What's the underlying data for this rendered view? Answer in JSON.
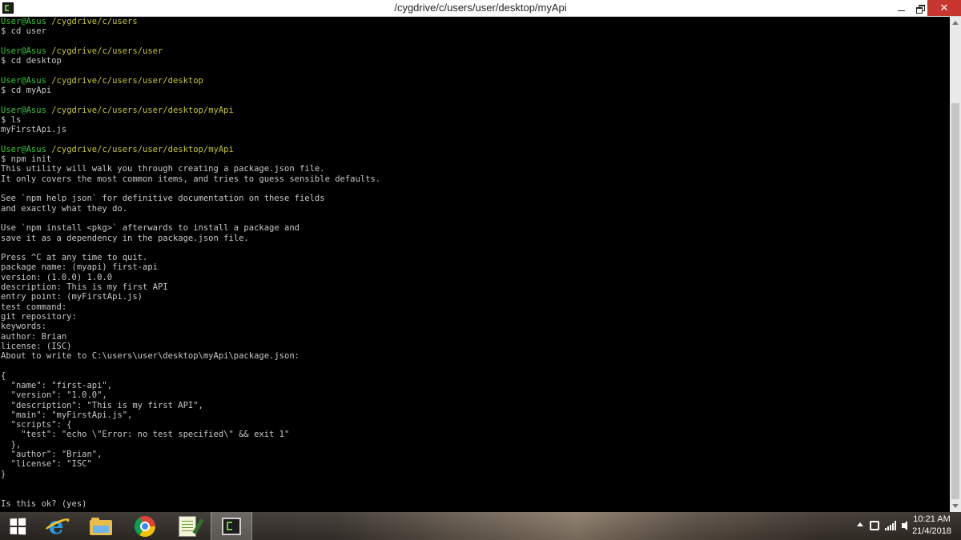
{
  "window": {
    "title": "/cygdrive/c/users/user/desktop/myApi",
    "minimize_glyph": "",
    "close_glyph": "✕"
  },
  "terminal": {
    "lines": [
      {
        "type": "prompt",
        "user": "User@Asus",
        "path": "/cygdrive/c/users"
      },
      {
        "type": "text",
        "text": "$ cd user"
      },
      {
        "type": "text",
        "text": ""
      },
      {
        "type": "prompt",
        "user": "User@Asus",
        "path": "/cygdrive/c/users/user"
      },
      {
        "type": "text",
        "text": "$ cd desktop"
      },
      {
        "type": "text",
        "text": ""
      },
      {
        "type": "prompt",
        "user": "User@Asus",
        "path": "/cygdrive/c/users/user/desktop"
      },
      {
        "type": "text",
        "text": "$ cd myApi"
      },
      {
        "type": "text",
        "text": ""
      },
      {
        "type": "prompt",
        "user": "User@Asus",
        "path": "/cygdrive/c/users/user/desktop/myApi"
      },
      {
        "type": "text",
        "text": "$ ls"
      },
      {
        "type": "text",
        "text": "myFirstApi.js"
      },
      {
        "type": "text",
        "text": ""
      },
      {
        "type": "prompt",
        "user": "User@Asus",
        "path": "/cygdrive/c/users/user/desktop/myApi"
      },
      {
        "type": "text",
        "text": "$ npm init"
      },
      {
        "type": "text",
        "text": "This utility will walk you through creating a package.json file."
      },
      {
        "type": "text",
        "text": "It only covers the most common items, and tries to guess sensible defaults."
      },
      {
        "type": "text",
        "text": ""
      },
      {
        "type": "text",
        "text": "See `npm help json` for definitive documentation on these fields"
      },
      {
        "type": "text",
        "text": "and exactly what they do."
      },
      {
        "type": "text",
        "text": ""
      },
      {
        "type": "text",
        "text": "Use `npm install <pkg>` afterwards to install a package and"
      },
      {
        "type": "text",
        "text": "save it as a dependency in the package.json file."
      },
      {
        "type": "text",
        "text": ""
      },
      {
        "type": "text",
        "text": "Press ^C at any time to quit."
      },
      {
        "type": "text",
        "text": "package name: (myapi) first-api"
      },
      {
        "type": "text",
        "text": "version: (1.0.0) 1.0.0"
      },
      {
        "type": "text",
        "text": "description: This is my first API"
      },
      {
        "type": "text",
        "text": "entry point: (myFirstApi.js)"
      },
      {
        "type": "text",
        "text": "test command:"
      },
      {
        "type": "text",
        "text": "git repository:"
      },
      {
        "type": "text",
        "text": "keywords:"
      },
      {
        "type": "text",
        "text": "author: Brian"
      },
      {
        "type": "text",
        "text": "license: (ISC)"
      },
      {
        "type": "text",
        "text": "About to write to C:\\users\\user\\desktop\\myApi\\package.json:"
      },
      {
        "type": "text",
        "text": ""
      },
      {
        "type": "text",
        "text": "{"
      },
      {
        "type": "text",
        "text": "  \"name\": \"first-api\","
      },
      {
        "type": "text",
        "text": "  \"version\": \"1.0.0\","
      },
      {
        "type": "text",
        "text": "  \"description\": \"This is my first API\","
      },
      {
        "type": "text",
        "text": "  \"main\": \"myFirstApi.js\","
      },
      {
        "type": "text",
        "text": "  \"scripts\": {"
      },
      {
        "type": "text",
        "text": "    \"test\": \"echo \\\"Error: no test specified\\\" && exit 1\""
      },
      {
        "type": "text",
        "text": "  },"
      },
      {
        "type": "text",
        "text": "  \"author\": \"Brian\","
      },
      {
        "type": "text",
        "text": "  \"license\": \"ISC\""
      },
      {
        "type": "text",
        "text": "}"
      },
      {
        "type": "text",
        "text": ""
      },
      {
        "type": "text",
        "text": ""
      },
      {
        "type": "text",
        "text": "Is this ok? (yes)"
      }
    ]
  },
  "taskbar": {
    "buttons": [
      {
        "name": "start-button",
        "icon": "windows-logo-icon"
      },
      {
        "name": "internet-explorer-button",
        "icon": "internet-explorer-icon",
        "glyph": "e"
      },
      {
        "name": "file-explorer-button",
        "icon": "folder-icon"
      },
      {
        "name": "chrome-button",
        "icon": "chrome-icon"
      },
      {
        "name": "notepad-plus-button",
        "icon": "notepad-icon"
      },
      {
        "name": "cygwin-button",
        "icon": "cygwin-terminal-icon",
        "active": true
      }
    ],
    "clock": {
      "time": "10:21 AM",
      "date": "21/4/2018"
    }
  },
  "colors": {
    "terminal_bg": "#000000",
    "terminal_fg": "#c8c8c8",
    "prompt_user": "#3ec43e",
    "prompt_path": "#c8c437",
    "close_button": "#c7372f"
  }
}
